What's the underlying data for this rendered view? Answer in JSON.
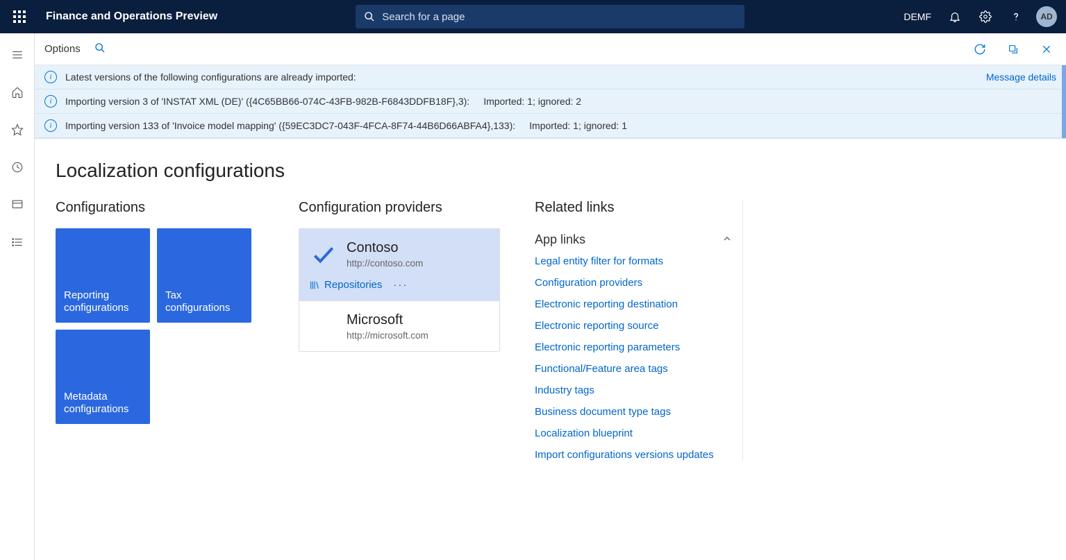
{
  "header": {
    "app_title": "Finance and Operations Preview",
    "search_placeholder": "Search for a page",
    "company": "DEMF",
    "avatar_initials": "AD"
  },
  "toolbar": {
    "options_label": "Options"
  },
  "banners": {
    "message_details_label": "Message details",
    "items": [
      {
        "main": "Latest versions of the following configurations are already imported:",
        "stat": ""
      },
      {
        "main": "Importing version 3 of 'INSTAT XML (DE)' ({4C65BB66-074C-43FB-982B-F6843DDFB18F},3):",
        "stat": "Imported: 1; ignored: 2"
      },
      {
        "main": "Importing version 133 of 'Invoice model mapping' ({59EC3DC7-043F-4FCA-8F74-44B6D66ABFA4},133):",
        "stat": "Imported: 1; ignored: 1"
      }
    ]
  },
  "page": {
    "title": "Localization configurations"
  },
  "configurations": {
    "heading": "Configurations",
    "tiles": [
      {
        "label": "Reporting configurations"
      },
      {
        "label": "Tax configurations"
      },
      {
        "label": "Metadata configurations"
      }
    ]
  },
  "providers": {
    "heading": "Configuration providers",
    "repositories_label": "Repositories",
    "items": [
      {
        "name": "Contoso",
        "url": "http://contoso.com",
        "active": true
      },
      {
        "name": "Microsoft",
        "url": "http://microsoft.com",
        "active": false
      }
    ]
  },
  "related_links": {
    "heading": "Related links",
    "app_links_heading": "App links",
    "items": [
      "Legal entity filter for formats",
      "Configuration providers",
      "Electronic reporting destination",
      "Electronic reporting source",
      "Electronic reporting parameters",
      "Functional/Feature area tags",
      "Industry tags",
      "Business document type tags",
      "Localization blueprint",
      "Import configurations versions updates"
    ]
  }
}
